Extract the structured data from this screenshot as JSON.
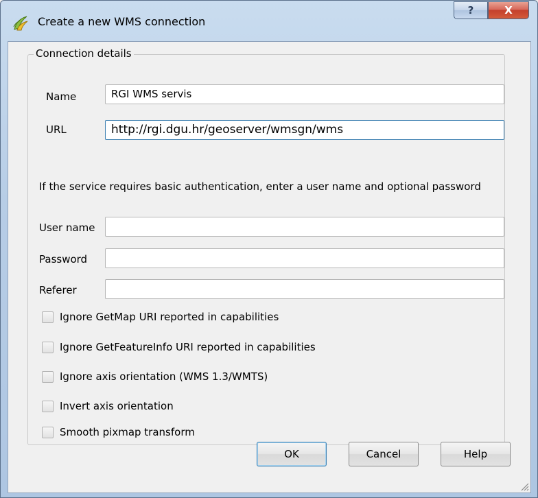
{
  "window": {
    "title": "Create a new WMS connection",
    "help_glyph": "?",
    "close_glyph": "X"
  },
  "group": {
    "title": "Connection details"
  },
  "fields": {
    "name_label": "Name",
    "name_value": "RGI WMS servis",
    "url_label": "URL",
    "url_value": "http://rgi.dgu.hr/geoserver/wmsgn/wms",
    "info_text": "If the service requires basic authentication, enter a user name and optional password",
    "username_label": "User name",
    "username_value": "",
    "password_label": "Password",
    "password_value": "",
    "referer_label": "Referer",
    "referer_value": ""
  },
  "checkboxes": [
    {
      "label": "Ignore GetMap URI reported in capabilities",
      "checked": false
    },
    {
      "label": "Ignore GetFeatureInfo URI reported in capabilities",
      "checked": false
    },
    {
      "label": "Ignore axis orientation (WMS 1.3/WMTS)",
      "checked": false
    },
    {
      "label": "Invert axis orientation",
      "checked": false
    },
    {
      "label": "Smooth pixmap transform",
      "checked": false
    }
  ],
  "buttons": {
    "ok": "OK",
    "cancel": "Cancel",
    "help": "Help"
  },
  "colors": {
    "focus_border": "#3c7fb1",
    "close_button": "#c4402c",
    "titlebar": "#b7cde6"
  },
  "icons": {
    "app": "qgis-logo-icon",
    "help": "question-mark-icon",
    "close": "close-icon",
    "resize": "resize-grip-icon"
  }
}
